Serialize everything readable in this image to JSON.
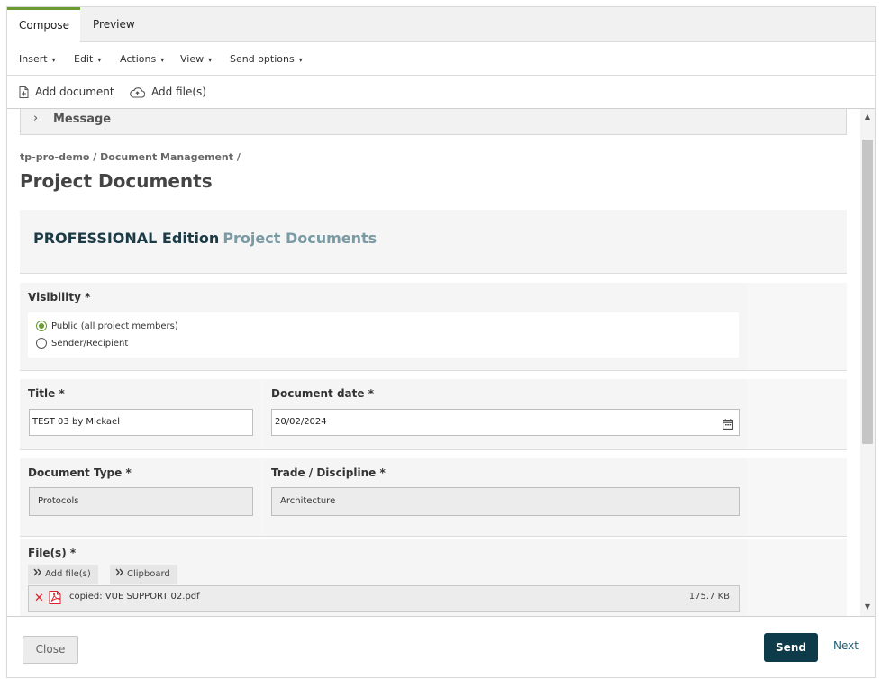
{
  "tabs": [
    {
      "label": "Compose",
      "active": true
    },
    {
      "label": "Preview",
      "active": false
    }
  ],
  "menus": [
    {
      "label": "Insert"
    },
    {
      "label": "Edit"
    },
    {
      "label": "Actions"
    },
    {
      "label": "View"
    },
    {
      "label": "Send options"
    }
  ],
  "menu_caret": "▾",
  "toolbar": {
    "add_document": "Add document",
    "add_files": "Add file(s)",
    "icons": [
      "document-plus-icon",
      "cloud-upload-icon"
    ]
  },
  "message_section": {
    "label": "Message",
    "expanded": false
  },
  "breadcrumb": "tp-pro-demo / Document Management /",
  "page_title": "Project Documents",
  "edition": {
    "strong": "PROFESSIONAL Edition",
    "light": "Project Documents"
  },
  "visibility": {
    "label": "Visibility *",
    "options": [
      {
        "label": "Public (all project members)",
        "checked": true
      },
      {
        "label": "Sender/Recipient",
        "checked": false
      }
    ]
  },
  "title_field": {
    "label": "Title *",
    "value": "TEST 03 by Mickael"
  },
  "date_field": {
    "label": "Document date *",
    "value": "20/02/2024"
  },
  "doc_type": {
    "label": "Document Type *",
    "value": "Protocols"
  },
  "trade": {
    "label": "Trade / Discipline *",
    "value": "Architecture"
  },
  "files": {
    "label": "File(s) *",
    "add_button": "Add file(s)",
    "clipboard_button": "Clipboard",
    "items": [
      {
        "name": "copied: VUE SUPPORT 02.pdf",
        "size": "175.7 KB"
      }
    ]
  },
  "footer": {
    "close": "Close",
    "send": "Send",
    "next": "Next"
  },
  "colors": {
    "accent_green": "#6a9a32",
    "send_button": "#0e3b49",
    "delete_red": "#d8202a"
  }
}
